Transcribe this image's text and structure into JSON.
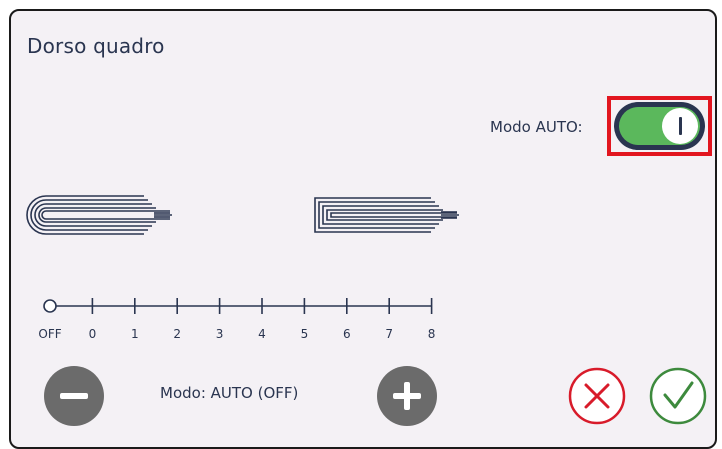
{
  "dialog": {
    "title": "Dorso quadro"
  },
  "auto_mode": {
    "label": "Modo AUTO:",
    "enabled": true
  },
  "scale": {
    "ticks": [
      "OFF",
      "0",
      "1",
      "2",
      "3",
      "4",
      "5",
      "6",
      "7",
      "8"
    ],
    "selected": "OFF"
  },
  "footer": {
    "mode_text": "Modo: AUTO (OFF)"
  },
  "icons": {
    "decrease": "minus-icon",
    "increase": "plus-icon",
    "cancel": "x-icon",
    "confirm": "check-icon",
    "round_spine": "book-round-spine-icon",
    "square_spine": "book-square-spine-icon"
  },
  "colors": {
    "text": "#2a3550",
    "toggle_on": "#5bb85c",
    "cancel": "#d81b2a",
    "confirm": "#3d8a3d",
    "highlight": "#e2161f",
    "step_button": "#6b6b6b"
  }
}
